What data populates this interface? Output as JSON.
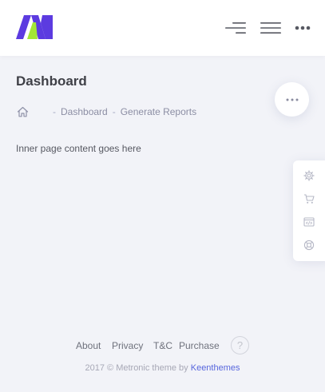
{
  "header": {
    "logo_icon": "metronic-m-logo",
    "menu_toggle_icon": "hamburger-left-align-icon",
    "topbar_toggle_icon": "hamburger-icon",
    "more_icon": "more-horizontal-icon",
    "colors": {
      "logo_purple": "#5c3be0",
      "logo_green": "#a3e635",
      "icon": "#575962"
    }
  },
  "subheader": {
    "title": "Dashboard",
    "quick_actions_icon": "more-horizontal-icon",
    "breadcrumb": {
      "home_icon": "home-icon",
      "separator": "-",
      "items": [
        "Dashboard",
        "Generate Reports"
      ]
    }
  },
  "content": {
    "text": "Inner page content goes here"
  },
  "sticky_toolbar": {
    "items": [
      "gear-icon",
      "cart-icon",
      "code-window-icon",
      "lifebuoy-icon"
    ]
  },
  "footer": {
    "nav": [
      "About",
      "Privacy",
      "T&C",
      "Purchase"
    ],
    "help": "?",
    "copyright_prefix": "2017 © Metronic theme by",
    "copyright_link": "Keenthemes",
    "colors": {
      "link": "#5867dd"
    }
  }
}
